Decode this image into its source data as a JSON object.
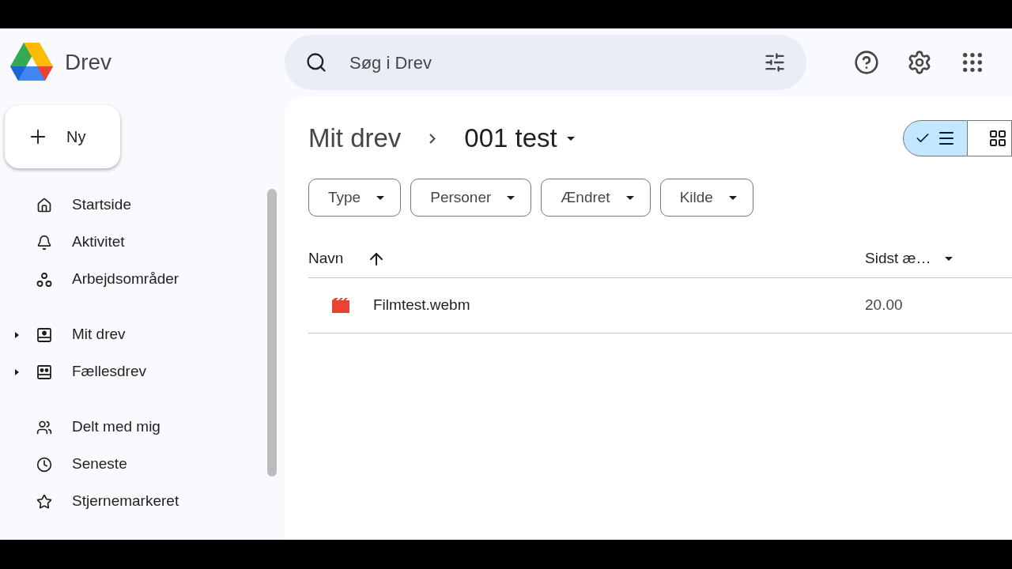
{
  "app": {
    "name": "Drev"
  },
  "search": {
    "placeholder": "Søg i Drev"
  },
  "new_button": {
    "label": "Ny"
  },
  "nav_groups": [
    [
      {
        "label": "Startside",
        "kind": "home",
        "selected": false
      },
      {
        "label": "Aktivitet",
        "kind": "bell",
        "selected": false
      },
      {
        "label": "Arbejdsområder",
        "kind": "nodes",
        "selected": false
      }
    ],
    [
      {
        "label": "Mit drev",
        "kind": "drive",
        "selected": false,
        "expanded": false
      },
      {
        "label": "Fællesdrev",
        "kind": "shared-drive",
        "selected": false,
        "expanded": false
      }
    ],
    [
      {
        "label": "Delt med mig",
        "kind": "people",
        "selected": false
      },
      {
        "label": "Seneste",
        "kind": "clock",
        "selected": false
      },
      {
        "label": "Stjernemarkeret",
        "kind": "star",
        "selected": false
      }
    ]
  ],
  "breadcrumb": [
    "Mit drev",
    "001 test"
  ],
  "view_toggle": [
    {
      "kind": "list",
      "selected": true
    },
    {
      "kind": "grid",
      "selected": false
    }
  ],
  "filters": [
    "Type",
    "Personer",
    "Ændret",
    "Kilde"
  ],
  "table": {
    "columns": [
      {
        "label": "Navn",
        "kind": "sorted"
      },
      {
        "label": "Sidst æ…",
        "kind": "menu"
      }
    ],
    "rows": [
      {
        "name": "Filmtest.webm",
        "kind": "video",
        "modified": "20.00"
      }
    ]
  }
}
